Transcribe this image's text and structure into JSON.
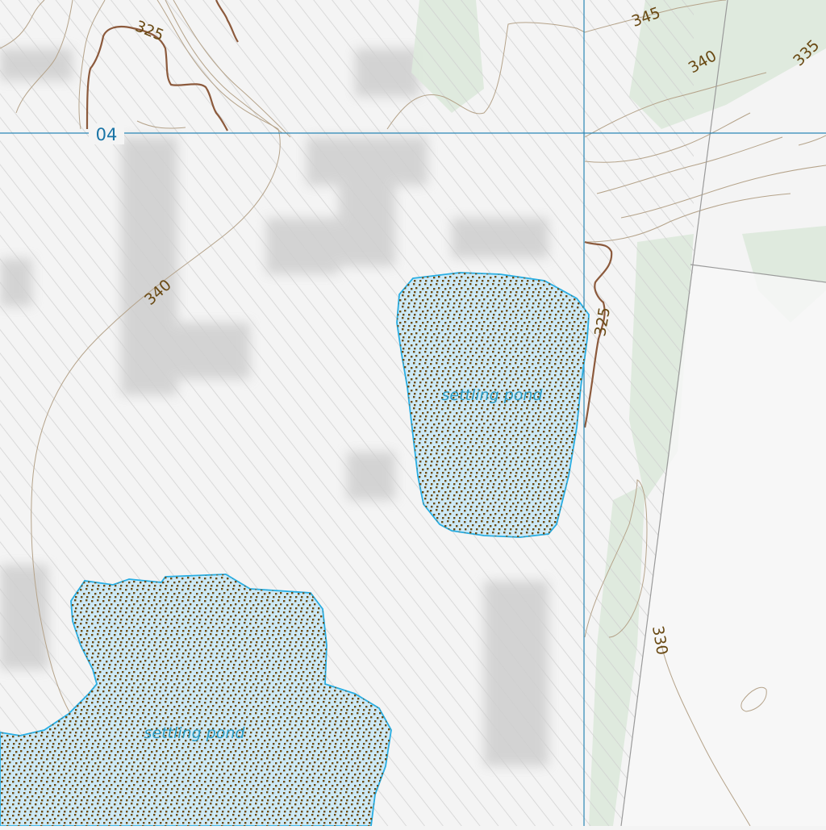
{
  "map": {
    "grid_labels": [
      {
        "text": "04"
      }
    ],
    "contour_labels": [
      {
        "text": "325",
        "kind": "index"
      },
      {
        "text": "345",
        "kind": "normal"
      },
      {
        "text": "340",
        "kind": "normal"
      },
      {
        "text": "335",
        "kind": "normal"
      },
      {
        "text": "340",
        "kind": "normal"
      },
      {
        "text": "325",
        "kind": "index"
      },
      {
        "text": "330",
        "kind": "normal"
      }
    ],
    "water_labels": [
      {
        "text": "settling pond"
      },
      {
        "text": "settling pond"
      }
    ],
    "colors": {
      "background": "#f4f4f4",
      "hatch": "#d2d2d2",
      "shaded_relief": "#c9c9c9",
      "vegetation": "#dde9dc",
      "water_fill": "#cde9f6",
      "water_outline": "#29aee3",
      "water_label": "#2a9cc6",
      "stipple": "#6b4a12",
      "contour": "#b5a38a",
      "index_contour": "#8c5a3c",
      "contour_label": "#6a4a14",
      "grid_line": "#2a86b6",
      "grid_label": "#1a74a6",
      "boundary_line": "#9a9a9a"
    }
  }
}
